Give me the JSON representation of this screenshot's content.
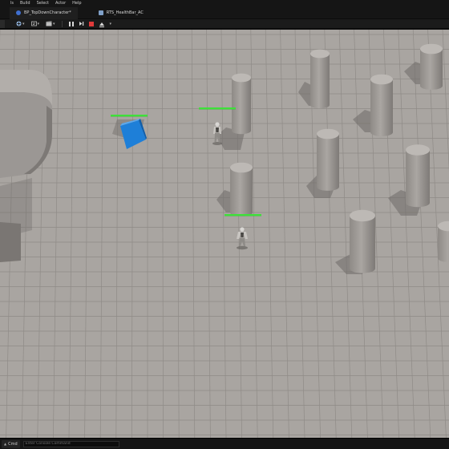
{
  "menu": {
    "items": [
      {
        "label": "ls"
      },
      {
        "label": "Build"
      },
      {
        "label": "Select"
      },
      {
        "label": "Actor"
      },
      {
        "label": "Help"
      }
    ]
  },
  "tabs": [
    {
      "label": "BP_TopDownCharacter*",
      "icon": "character-blueprint-icon"
    },
    {
      "label": "RTS_HealthBar_AC",
      "icon": "actor-component-icon"
    }
  ],
  "toolbar": {
    "buttons": [
      {
        "name": "add-actor-button",
        "icon": "add-actor-icon"
      },
      {
        "name": "blueprint-menu-button",
        "icon": "blueprint-icon"
      },
      {
        "name": "cinematics-button",
        "icon": "clapperboard-icon"
      }
    ],
    "play_controls": [
      {
        "name": "pause-button",
        "icon": "pause-icon"
      },
      {
        "name": "skip-frame-button",
        "icon": "frame-skip-icon"
      },
      {
        "name": "stop-button",
        "icon": "stop-icon"
      },
      {
        "name": "eject-button",
        "icon": "eject-icon"
      }
    ]
  },
  "scene": {
    "floor_color": "#a9a5a1",
    "grid_line_color": "#8f8b87",
    "pillar_color": "#a29e9a",
    "shadow_color": "#6d6a67",
    "cube_color": "#1e7fd8",
    "health_bar_color": "#3ee03a",
    "characters": [
      {
        "name": "player-character",
        "health": 1.0
      },
      {
        "name": "enemy-character",
        "health": 1.0
      }
    ],
    "cube_health": 1.0
  },
  "status": {
    "cmd_label": "Cmd",
    "console_placeholder": "Enter Console Command"
  },
  "colors": {
    "menubar_bg": "#151515",
    "toolbar_bg": "#1b1b1b",
    "stop_red": "#e03a3a"
  }
}
